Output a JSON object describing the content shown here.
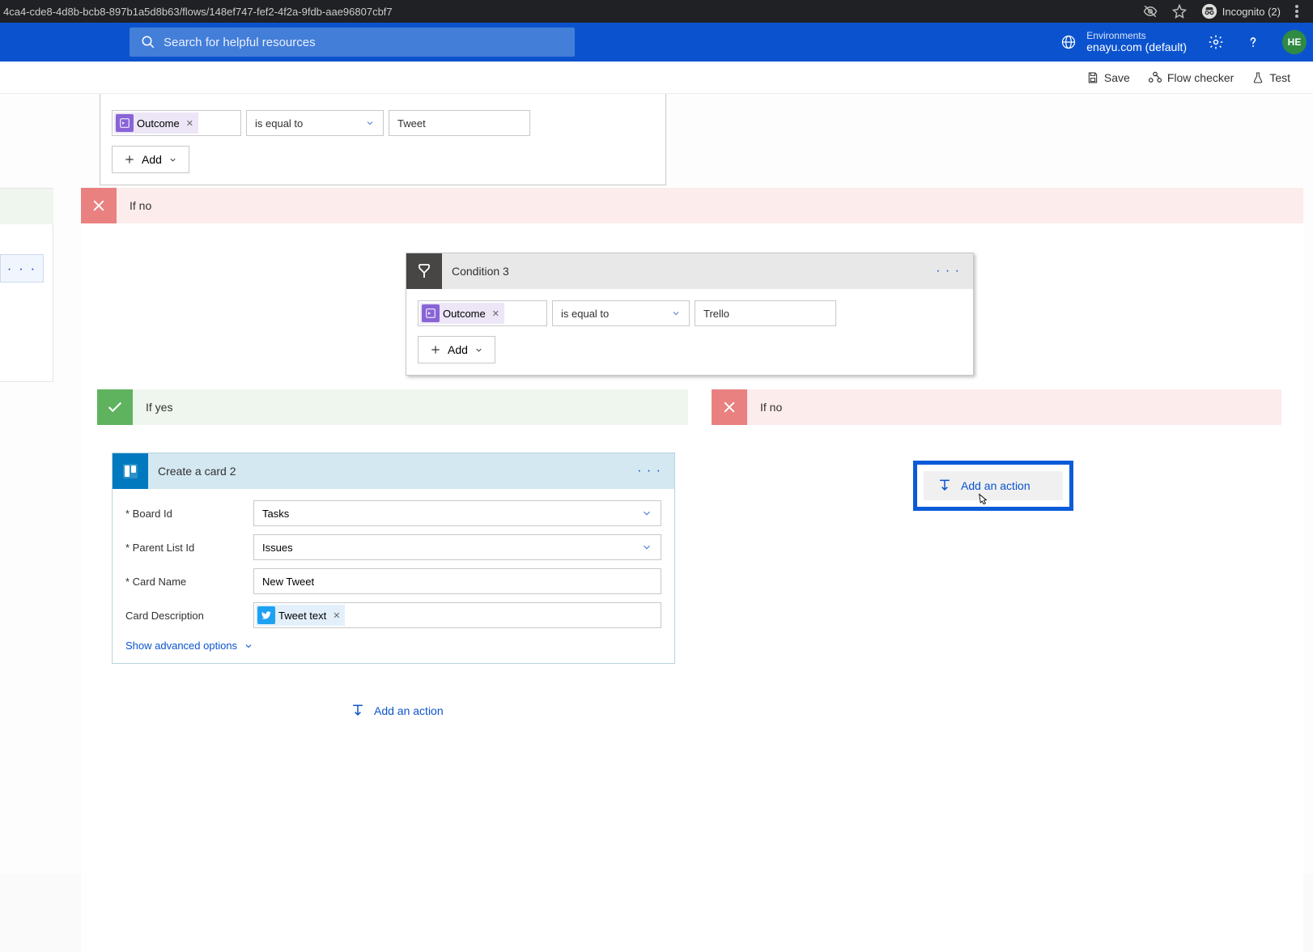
{
  "browser": {
    "url": "4ca4-cde8-4d8b-bcb8-897b1a5d8b63/flows/148ef747-fef2-4f2a-9fdb-aae96807cbf7",
    "incognito": "Incognito (2)"
  },
  "header": {
    "search_placeholder": "Search for helpful resources",
    "environments_label": "Environments",
    "environments_value": "enayu.com (default)",
    "avatar_initials": "HE"
  },
  "commands": {
    "save": "Save",
    "flow_checker": "Flow checker",
    "test": "Test"
  },
  "top_condition": {
    "outcome_chip": "Outcome",
    "operator": "is equal to",
    "value": "Tweet",
    "add": "Add"
  },
  "branch1_no": {
    "label": "If no"
  },
  "condition3": {
    "title": "Condition 3",
    "outcome_chip": "Outcome",
    "operator": "is equal to",
    "value": "Trello",
    "add": "Add"
  },
  "branch2": {
    "yes": {
      "label": "If yes"
    },
    "no": {
      "label": "If no"
    },
    "add_action": "Add an action"
  },
  "trello": {
    "title": "Create a card 2",
    "board_label": "* Board Id",
    "board_value": "Tasks",
    "list_label": "* Parent List Id",
    "list_value": "Issues",
    "card_name_label": "* Card Name",
    "card_name_value": "New Tweet",
    "desc_label": "Card Description",
    "desc_chip": "Tweet text",
    "advanced": "Show advanced options"
  },
  "yes_add_action": "Add an action"
}
